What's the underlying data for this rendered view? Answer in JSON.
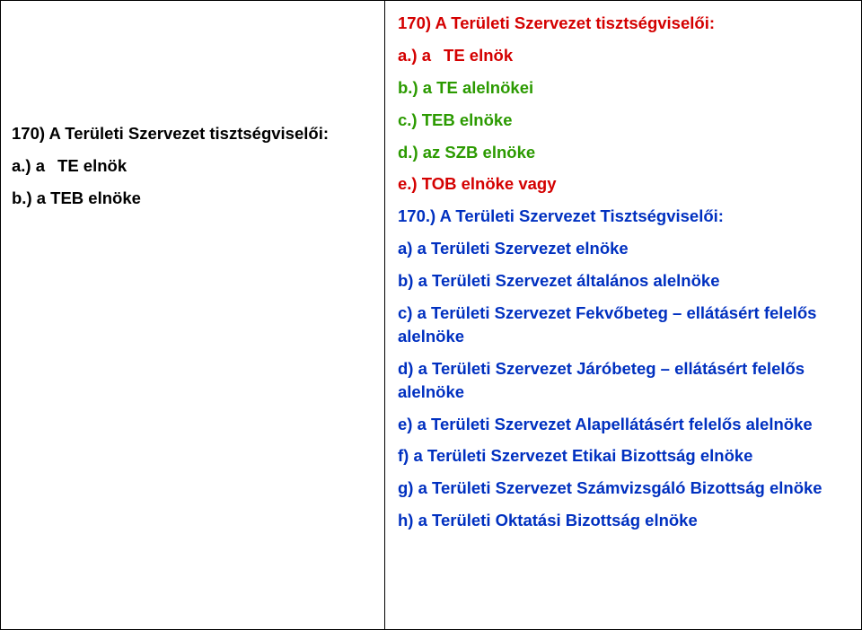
{
  "left": {
    "h": "170) A Területi Szervezet tisztségviselői:",
    "a": "a.) a",
    "a2": "TE elnök",
    "b": "b.) a TEB elnöke"
  },
  "right": {
    "h": "170) A Területi Szervezet tisztségviselői:",
    "a": "a.) a",
    "a2": "TE elnök",
    "b": "b.) a TE alelnökei",
    "c": "c.) TEB elnöke",
    "d": "d.) az SZB elnöke",
    "e": "e.) TOB elnöke  vagy",
    "h2": "170.) A Területi Szervezet Tisztségviselői:",
    "ia": "a)  a Területi Szervezet elnöke",
    "ib": "b)  a Területi Szervezet általános alelnöke",
    "ic": "c)  a Területi Szervezet Fekvőbeteg – ellátásért felelős alelnöke",
    "id": "d)  a Területi Szervezet Járóbeteg – ellátásért felelős alelnöke",
    "ie": "e)  a Területi Szervezet Alapellátásért felelős alelnöke",
    "if": "f)  a Területi Szervezet Etikai Bizottság elnöke",
    "ig": "g)  a Területi Szervezet Számvizsgáló Bizottság elnöke",
    "ih": "h)  a Területi Oktatási Bizottság elnöke"
  }
}
